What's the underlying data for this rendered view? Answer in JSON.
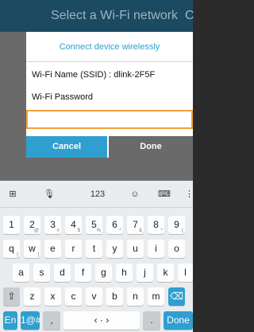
{
  "backdrop": {
    "title": "Select a Wi-Fi network",
    "close_glyph": "C"
  },
  "dialog": {
    "title": "Connect device wirelessly",
    "ssid_text": "Wi-Fi Name (SSID) : dlink-2F5F",
    "password_label": "Wi-Fi Password",
    "password_value": "",
    "cancel_label": "Cancel",
    "done_label": "Done"
  },
  "keyboard": {
    "toolbar": {
      "clipboard": "⊞",
      "mic": "🎙",
      "numbers": "123",
      "emoji": "☺",
      "keyboard": "⌨",
      "more": "⋮"
    },
    "row1": [
      {
        "main": "1",
        "sub": ""
      },
      {
        "main": "2",
        "sub": "@"
      },
      {
        "main": "3",
        "sub": "#"
      },
      {
        "main": "4",
        "sub": "$"
      },
      {
        "main": "5",
        "sub": "%"
      },
      {
        "main": "6",
        "sub": "^"
      },
      {
        "main": "7",
        "sub": "&"
      },
      {
        "main": "8",
        "sub": "*"
      },
      {
        "main": "9",
        "sub": "("
      }
    ],
    "row2": [
      {
        "main": "q",
        "sub": "["
      },
      {
        "main": "w",
        "sub": "]"
      },
      {
        "main": "e",
        "sub": ""
      },
      {
        "main": "r",
        "sub": ""
      },
      {
        "main": "t",
        "sub": ""
      },
      {
        "main": "y",
        "sub": ""
      },
      {
        "main": "u",
        "sub": ""
      },
      {
        "main": "i",
        "sub": ""
      },
      {
        "main": "o",
        "sub": ""
      }
    ],
    "row3": [
      {
        "main": "a",
        "sub": ""
      },
      {
        "main": "s",
        "sub": ""
      },
      {
        "main": "d",
        "sub": ""
      },
      {
        "main": "f",
        "sub": ""
      },
      {
        "main": "g",
        "sub": ""
      },
      {
        "main": "h",
        "sub": ""
      },
      {
        "main": "j",
        "sub": ""
      },
      {
        "main": "k",
        "sub": ""
      },
      {
        "main": "l",
        "sub": ""
      }
    ],
    "row4": [
      {
        "main": "⇧",
        "sub": ""
      },
      {
        "main": "z",
        "sub": ""
      },
      {
        "main": "x",
        "sub": ""
      },
      {
        "main": "c",
        "sub": ""
      },
      {
        "main": "v",
        "sub": ""
      },
      {
        "main": "b",
        "sub": ""
      },
      {
        "main": "n",
        "sub": ""
      },
      {
        "main": "m",
        "sub": ""
      },
      {
        "main": "⌫",
        "sub": ""
      }
    ],
    "row5": [
      {
        "main": "En",
        "sub": ""
      },
      {
        "main": "1@#",
        "sub": ""
      },
      {
        "main": ",",
        "sub": ""
      },
      {
        "main": "‹  ·  ›",
        "sub": ""
      },
      {
        "main": ".",
        "sub": ""
      },
      {
        "main": "Done",
        "sub": ""
      }
    ]
  }
}
